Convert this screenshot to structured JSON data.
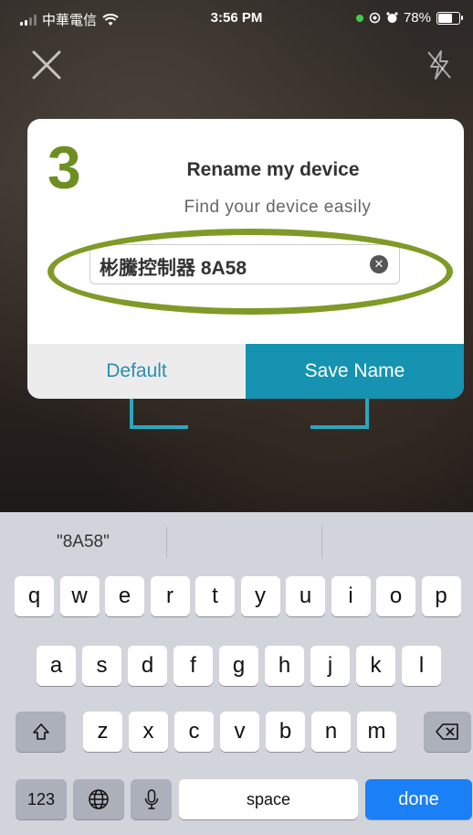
{
  "status_bar": {
    "carrier": "中華電信",
    "time": "3:56 PM",
    "battery": "78%",
    "battery_level": 0.78
  },
  "dialog": {
    "step": "3",
    "title": "Rename my device",
    "subtitle": "Find your device easily",
    "input_value": "彬騰控制器 8A58",
    "default_label": "Default",
    "save_label": "Save Name"
  },
  "keyboard": {
    "suggestion": "\"8A58\"",
    "row1": [
      "q",
      "w",
      "e",
      "r",
      "t",
      "y",
      "u",
      "i",
      "o",
      "p"
    ],
    "row2": [
      "a",
      "s",
      "d",
      "f",
      "g",
      "h",
      "j",
      "k",
      "l"
    ],
    "row3": [
      "z",
      "x",
      "c",
      "v",
      "b",
      "n",
      "m"
    ],
    "numbers_label": "123",
    "space_label": "space",
    "done_label": "done"
  },
  "colors": {
    "accent": "#1593b1",
    "step_green": "#6d8f22",
    "highlight_ring": "#7f9a26",
    "done_blue": "#1a80f7"
  },
  "icons": [
    "close-icon",
    "flash-off-icon",
    "wifi-icon",
    "location-icon",
    "alarm-icon",
    "clear-icon",
    "shift-icon",
    "backspace-icon",
    "globe-icon",
    "microphone-icon"
  ]
}
